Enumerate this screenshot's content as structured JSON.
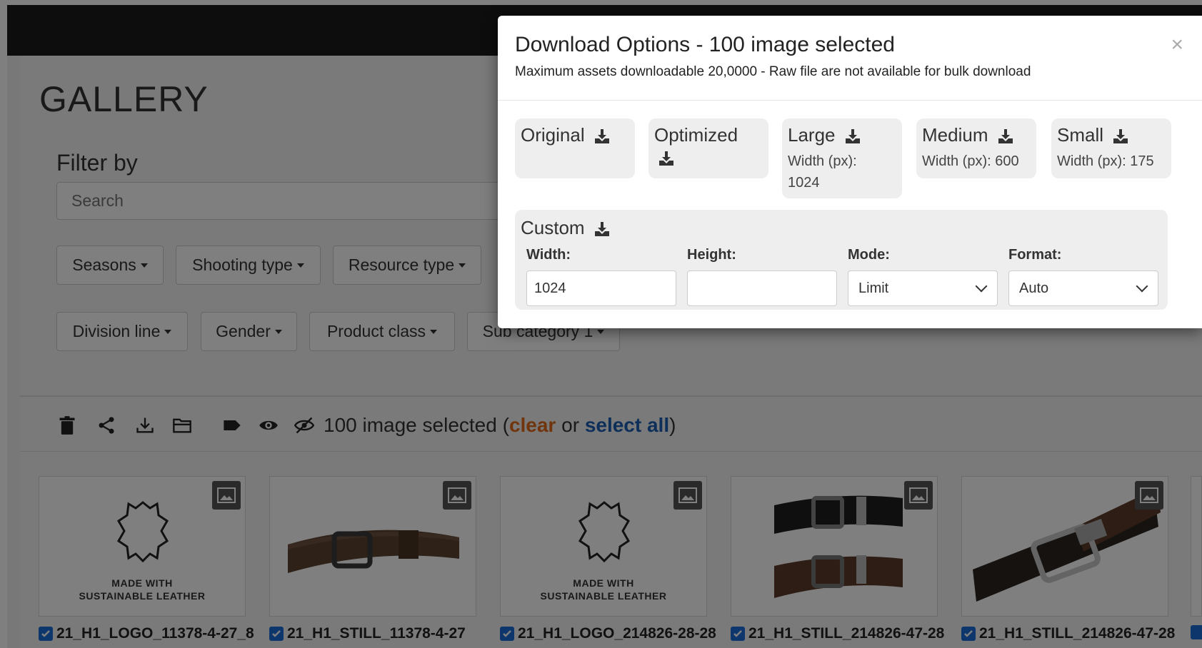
{
  "gallery": {
    "title": "GALLERY",
    "filter_label": "Filter by",
    "search_placeholder": "Search",
    "filters_row1": [
      "Seasons",
      "Shooting type",
      "Resource type"
    ],
    "filters_row2": [
      "Division line",
      "Gender",
      "Product class",
      "Sub category 1"
    ]
  },
  "toolbar": {
    "icons": [
      "trash-icon",
      "share-icon",
      "download-icon",
      "folder-icon",
      "tag-icon",
      "eye-icon",
      "eye-slash-icon"
    ],
    "selected_text": "100 image selected",
    "clear_label": "clear",
    "or_text": "or",
    "select_all_label": "select all"
  },
  "cards": [
    {
      "name": "21_H1_LOGO_11378-4-27_8",
      "type": "leather",
      "caption_line1": "MADE WITH",
      "caption_line2": "SUSTAINABLE LEATHER"
    },
    {
      "name": "21_H1_STILL_11378-4-27",
      "type": "belt-brown"
    },
    {
      "name": "21_H1_LOGO_214826-28-28",
      "type": "leather",
      "caption_line1": "MADE WITH",
      "caption_line2": "SUSTAINABLE LEATHER"
    },
    {
      "name": "21_H1_STILL_214826-47-28",
      "type": "belt-double"
    },
    {
      "name": "21_H1_STILL_214826-47-28",
      "type": "belt-buckle"
    }
  ],
  "modal": {
    "title": "Download Options - 100 image selected",
    "subtitle": "Maximum assets downloadable 20,0000 - Raw file are not available for bulk download",
    "close": "×",
    "options": [
      {
        "label": "Original",
        "detail": ""
      },
      {
        "label": "Optimized",
        "detail": ""
      },
      {
        "label": "Large",
        "detail": "Width (px): 1024"
      },
      {
        "label": "Medium",
        "detail": "Width (px): 600"
      },
      {
        "label": "Small",
        "detail": "Width (px): 175"
      }
    ],
    "custom": {
      "title": "Custom",
      "width_label": "Width:",
      "height_label": "Height:",
      "mode_label": "Mode:",
      "format_label": "Format:",
      "width_value": "1024",
      "height_value": "",
      "mode_value": "Limit",
      "format_value": "Auto"
    }
  },
  "colors": {
    "topbar": "#1b1b1b",
    "clear_link": "#e06a1b",
    "select_all_link": "#1a5fb4",
    "checkbox": "#1a6fd8"
  }
}
